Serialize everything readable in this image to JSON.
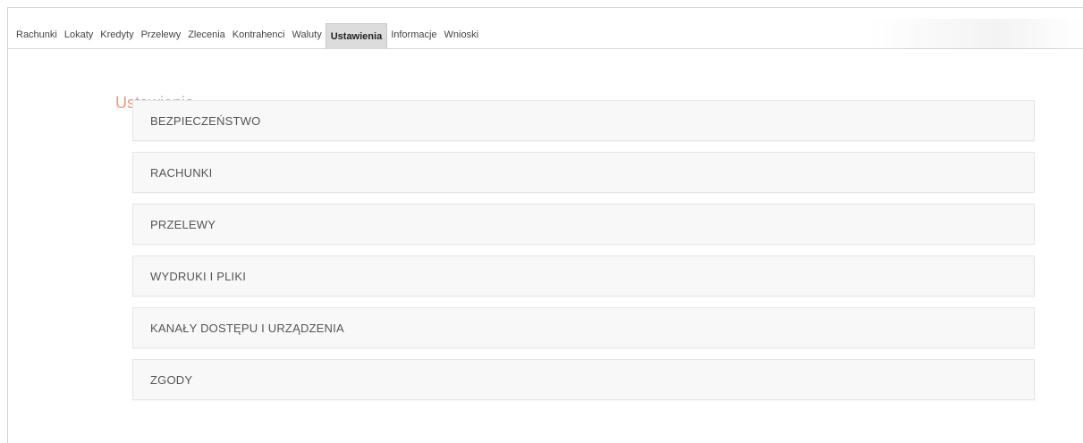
{
  "topnav": {
    "items": [
      {
        "label": "Rachunki",
        "active": false
      },
      {
        "label": "Lokaty",
        "active": false
      },
      {
        "label": "Kredyty",
        "active": false
      },
      {
        "label": "Przelewy",
        "active": false
      },
      {
        "label": "Zlecenia",
        "active": false
      },
      {
        "label": "Kontrahenci",
        "active": false
      },
      {
        "label": "Waluty",
        "active": false
      },
      {
        "label": "Ustawienia",
        "active": true
      },
      {
        "label": "Informacje",
        "active": false
      },
      {
        "label": "Wnioski",
        "active": false
      }
    ]
  },
  "main": {
    "title": "Ustawienia",
    "menu": [
      {
        "label": "BEZPIECZEŃSTWO"
      },
      {
        "label": "RACHUNKI"
      },
      {
        "label": "PRZELEWY"
      },
      {
        "label": "WYDRUKI I PLIKI"
      },
      {
        "label": "KANAŁY DOSTĘPU I URZĄDZENIA"
      },
      {
        "label": "ZGODY"
      }
    ]
  },
  "colors": {
    "title_accent": "#f0977a",
    "active_tab_bg": "#dcdcdc",
    "menu_item_bg": "#f8f8f8"
  }
}
